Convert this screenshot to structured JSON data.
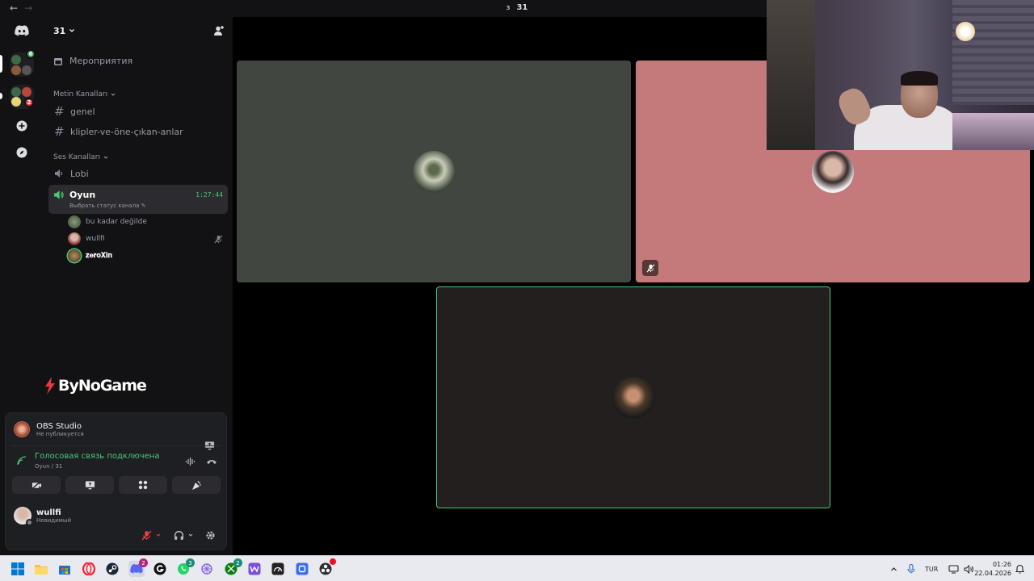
{
  "topbar": {
    "back_glyph": "←",
    "forward_glyph": "→",
    "member_count": "3",
    "title": "31"
  },
  "guilds": {
    "items": [
      {
        "name": "discord-home",
        "icon": "discord-icon"
      },
      {
        "name": "server-folder-1",
        "badge": "6"
      },
      {
        "name": "server-folder-2",
        "badge": "2"
      },
      {
        "name": "add-server",
        "icon": "plus-icon"
      },
      {
        "name": "discover",
        "icon": "compass-icon"
      }
    ]
  },
  "server": {
    "name": "31",
    "events_label": "Мероприятия"
  },
  "categories": {
    "text": "Metin Kanalları",
    "voice": "Ses Kanalları"
  },
  "text_channels": [
    {
      "label": "genel"
    },
    {
      "label": "klipler-ve-öne-çıkan-anlar"
    }
  ],
  "voice_channels": {
    "lobi": "Lobi",
    "active": {
      "name": "Oyun",
      "timer": "1:27:44",
      "status": "Выбрать статус канала"
    },
    "users": [
      {
        "name": "bu kadar değilde"
      },
      {
        "name": "wullfi"
      },
      {
        "name": "𝐳𝐞𝐫𝐨𝐗𝐢𝐧"
      }
    ]
  },
  "overlay_logo": {
    "text": "ByNoGame"
  },
  "panel": {
    "obs_title": "OBS Studio",
    "obs_subtitle": "Не публикуется",
    "voice_status": "Голосовая связь подключена",
    "voice_channel": "Oyun / 31",
    "user_name": "wullfi",
    "user_status": "Невидимый"
  },
  "colors": {
    "connected": "#4ac87a",
    "tile_left": "#414641",
    "tile_right": "#c47a7a",
    "tile_bottom": "#231f1f",
    "speaking": "#4ac87a"
  },
  "taskbar": {
    "badges": {
      "discord": "2",
      "whatsapp": "3",
      "xbox": "2"
    },
    "lang": "TUR",
    "time": "01:26",
    "date": "22.04.2026"
  }
}
